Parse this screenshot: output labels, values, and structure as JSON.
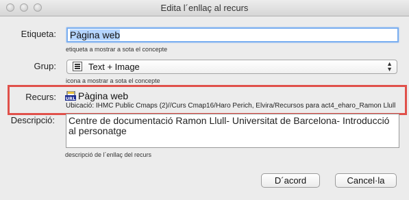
{
  "window": {
    "title": "Edita l´enllaç al recurs"
  },
  "etiqueta": {
    "label": "Etiqueta:",
    "value": "Pàgina web",
    "hint": "etiqueta a mostrar a sota el concepte"
  },
  "grup": {
    "label": "Grup:",
    "selected": "Text + Image",
    "hint": "icona a mostrar a sota el concepte"
  },
  "recurs": {
    "label": "Recurs:",
    "title": "Pàgina web",
    "location": "Ubicació: IHMC Public Cmaps (2)//Curs Cmap16/Haro Perich, Elvira/Recursos para act4_eharo_Ramon Llull",
    "icon": "url-file-icon",
    "highlight_color": "#e0504a"
  },
  "descripcio": {
    "label": "Descripció:",
    "value": "Centre de documentació Ramon Llull- Universitat de Barcelona- Introducció al personatge",
    "hint": "descripció de l´enllaç del recurs"
  },
  "buttons": {
    "ok": "D´acord",
    "cancel": "Cancel·la"
  }
}
